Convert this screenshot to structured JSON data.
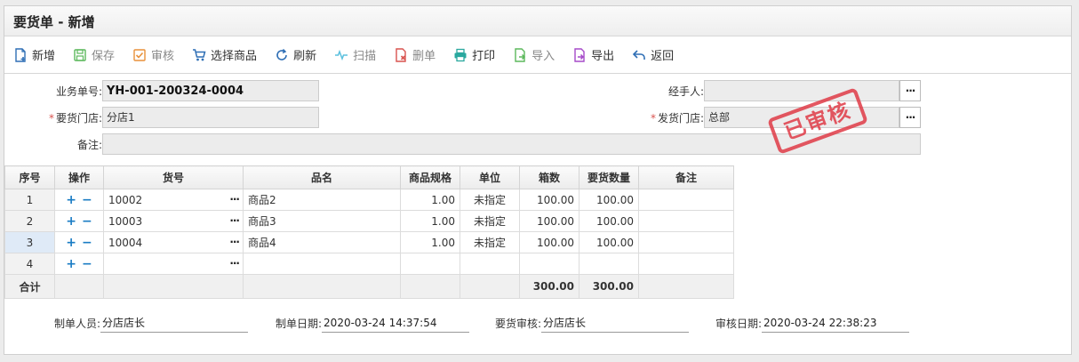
{
  "window": {
    "title": "要货单 - 新增"
  },
  "toolbar": {
    "new": "新增",
    "save": "保存",
    "audit": "审核",
    "select_goods": "选择商品",
    "refresh": "刷新",
    "scan": "扫描",
    "delete": "删单",
    "print": "打印",
    "import": "导入",
    "export": "导出",
    "back": "返回"
  },
  "form": {
    "doc_no_label": "业务单号:",
    "doc_no": "YH-001-200324-0004",
    "req_store_label": "要货门店:",
    "req_store": "分店1",
    "remark_label": "备注:",
    "remark": "",
    "handler_label": "经手人:",
    "handler": "",
    "ship_store_label": "发货门店:",
    "ship_store": "总部",
    "required_mark": "*"
  },
  "stamp": {
    "text": "已审核",
    "color": "#e03b47"
  },
  "table": {
    "headers": [
      "序号",
      "操作",
      "货号",
      "品名",
      "商品规格",
      "单位",
      "箱数",
      "要货数量",
      "备注"
    ],
    "rows": [
      {
        "idx": "1",
        "code": "10002",
        "name": "商品2",
        "spec": "1.00",
        "unit": "未指定",
        "boxes": "100.00",
        "qty": "100.00",
        "note": ""
      },
      {
        "idx": "2",
        "code": "10003",
        "name": "商品3",
        "spec": "1.00",
        "unit": "未指定",
        "boxes": "100.00",
        "qty": "100.00",
        "note": ""
      },
      {
        "idx": "3",
        "code": "10004",
        "name": "商品4",
        "spec": "1.00",
        "unit": "未指定",
        "boxes": "100.00",
        "qty": "100.00",
        "note": ""
      },
      {
        "idx": "4",
        "code": "",
        "name": "",
        "spec": "",
        "unit": "",
        "boxes": "",
        "qty": "",
        "note": ""
      }
    ],
    "total_label": "合计",
    "total_boxes": "300.00",
    "total_qty": "300.00",
    "op_add": "+",
    "op_remove": "−",
    "picker": "···"
  },
  "footer": {
    "maker_label": "制单人员:",
    "maker": "分店店长",
    "make_date_label": "制单日期:",
    "make_date": "2020-03-24 14:37:54",
    "auditor_label": "要货审核:",
    "auditor": "分店店长",
    "audit_date_label": "审核日期:",
    "audit_date": "2020-03-24 22:38:23"
  }
}
